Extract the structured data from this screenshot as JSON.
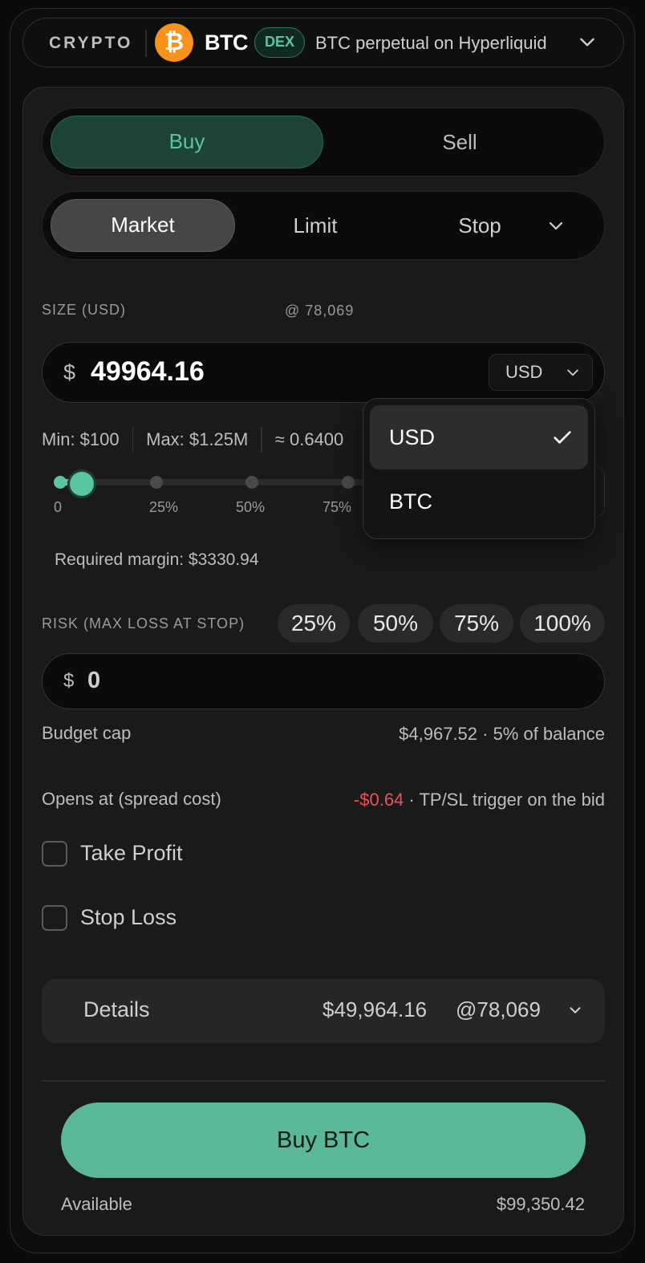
{
  "header": {
    "category": "CRYPTO",
    "logo_glyph": "₿",
    "symbol": "BTC",
    "badge": "DEX",
    "description": "BTC perpetual on Hyperliquid"
  },
  "side_tabs": {
    "buy": "Buy",
    "sell": "Sell",
    "selected": "Buy"
  },
  "order_tabs": {
    "market": "Market",
    "limit": "Limit",
    "stop": "Stop",
    "selected": "Market"
  },
  "size": {
    "label": "SIZE (USD)",
    "price_ref": "@ 78,069",
    "currency_symbol": "$",
    "value": "49964.16",
    "unit": "USD",
    "min": "Min: $100",
    "max": "Max: $1.25M",
    "approx": "≈ 0.6400"
  },
  "slider": {
    "level_percent": 5,
    "ticks": [
      "0",
      "25%",
      "50%",
      "75%"
    ]
  },
  "margin": "Required margin: $3330.94",
  "risk": {
    "label": "RISK (MAX LOSS AT STOP)",
    "presets": [
      "25%",
      "50%",
      "75%",
      "100%"
    ],
    "currency_symbol": "$",
    "value": "0"
  },
  "budget": {
    "label": "Budget cap",
    "value": "$4,967.52 · 5% of balance"
  },
  "opens": {
    "label": "Opens at (spread cost)",
    "cost": "-$0.64",
    "note": " · TP/SL trigger on the bid"
  },
  "take_profit": {
    "label": "Take Profit",
    "checked": false
  },
  "stop_loss": {
    "label": "Stop Loss",
    "checked": false
  },
  "details": {
    "title": "Details",
    "amount": "$49,964.16",
    "at_price": "@78,069"
  },
  "buy_button": "Buy BTC",
  "available": {
    "label": "Available",
    "value": "$99,350.42"
  },
  "unit_dropdown": {
    "options": [
      "USD",
      "BTC"
    ],
    "selected": "USD"
  },
  "colors": {
    "accent": "#5bc4a0",
    "button": "#5bb896",
    "negative": "#e85454",
    "bitcoin": "#f7931a"
  }
}
